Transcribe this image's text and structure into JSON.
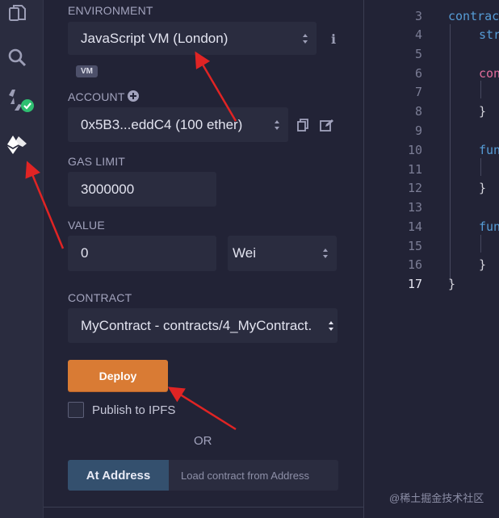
{
  "run_panel": {
    "environment": {
      "label": "ENVIRONMENT",
      "value": "JavaScript VM (London)",
      "badge": "VM"
    },
    "account": {
      "label": "ACCOUNT",
      "value": "0x5B3...eddC4 (100 ether)"
    },
    "gas_limit": {
      "label": "GAS LIMIT",
      "value": "3000000"
    },
    "value": {
      "label": "VALUE",
      "amount": "0",
      "unit": "Wei"
    },
    "contract": {
      "label": "CONTRACT",
      "value": "MyContract - contracts/4_MyContract."
    },
    "deploy_label": "Deploy",
    "publish_label": "Publish to IPFS",
    "or_label": "OR",
    "at_address_label": "At Address",
    "at_address_placeholder": "Load contract from Address"
  },
  "editor": {
    "line_numbers": [
      "3",
      "4",
      "5",
      "6",
      "7",
      "8",
      "9",
      "10",
      "11",
      "12",
      "13",
      "14",
      "15",
      "16",
      "17"
    ],
    "current_line": "17",
    "lines": {
      "l3": "contrac",
      "l4": "str",
      "l6": "con",
      "l8": "}",
      "l10": "fun",
      "l12": "}",
      "l14": "fun",
      "l16": "}",
      "l17": "}"
    }
  },
  "watermark": "@稀土掘金技术社区",
  "colors": {
    "accent_deploy": "#d97b34",
    "at_address": "#34506e",
    "check_green": "#2fbf71",
    "arrow_red": "#e02424"
  }
}
